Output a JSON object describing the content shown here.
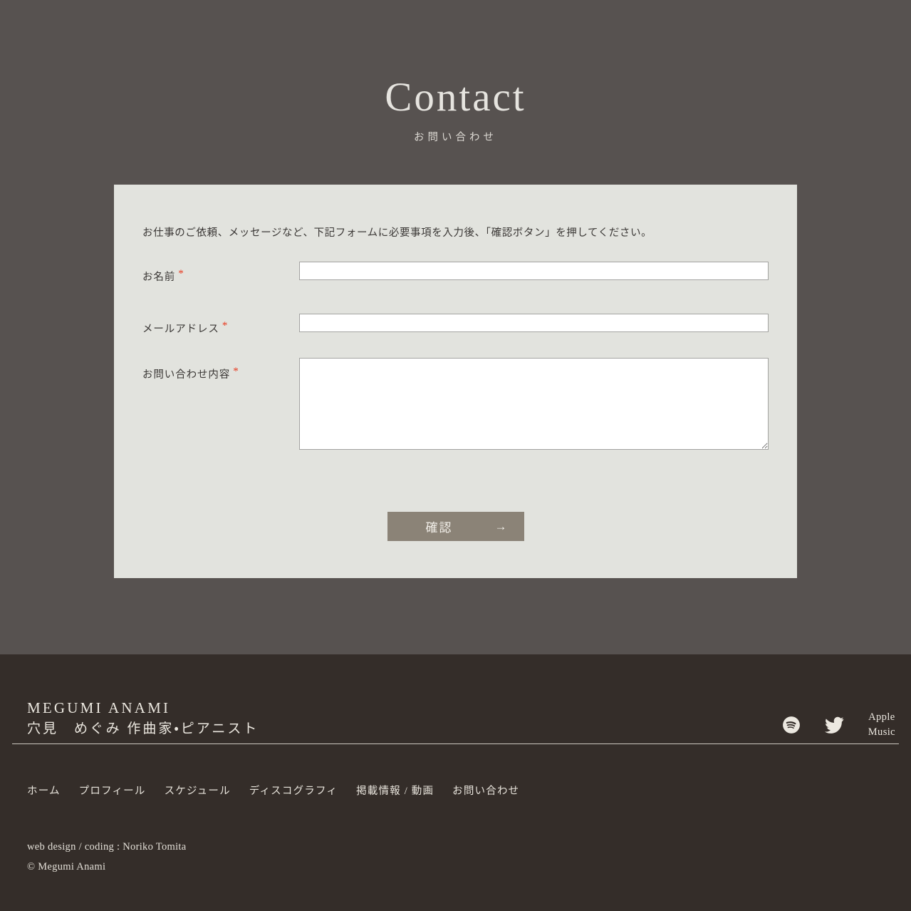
{
  "hero": {
    "title": "Contact",
    "subtitle": "お問い合わせ"
  },
  "form": {
    "intro": "お仕事のご依頼、メッセージなど、下記フォームに必要事項を入力後、「確認ボタン」を押してください。",
    "required_mark": "*",
    "fields": [
      {
        "label": "お名前",
        "value": "",
        "placeholder": "",
        "type": "text"
      },
      {
        "label": "メールアドレス",
        "value": "",
        "placeholder": "",
        "type": "text"
      },
      {
        "label": "お問い合わせ内容",
        "value": "",
        "placeholder": "",
        "type": "textarea"
      }
    ],
    "submit_label": "確認",
    "submit_arrow": "→"
  },
  "footer": {
    "brand_name": "MEGUMI ANAMI",
    "brand_sub": "穴見　めぐみ 作曲家・ピアニスト",
    "social": {
      "spotify_name": "spotify-icon",
      "twitter_name": "twitter-icon",
      "apple_music_line1": "Apple",
      "apple_music_line2": "Music"
    },
    "nav": [
      "ホーム",
      "プロフィール",
      "スケジュール",
      "ディスコグラフィ",
      "掲載情報 / 動画",
      "お問い合わせ"
    ],
    "credits": [
      "web design / coding : Noriko Tomita",
      "© Megumi Anami"
    ]
  },
  "colors": {
    "background": "#575250",
    "panel": "#e2e3de",
    "footer": "#342d29",
    "button": "#8b8377",
    "required": "#e83a20",
    "text_light": "#e8e4dc"
  }
}
